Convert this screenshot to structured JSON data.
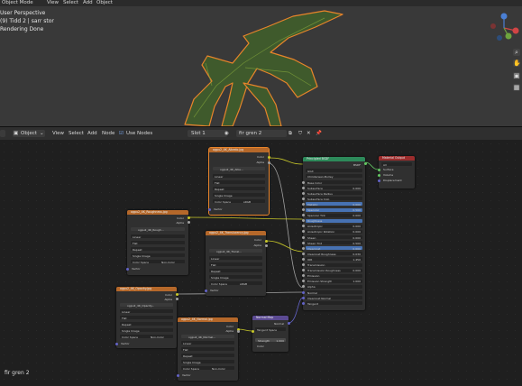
{
  "viewport": {
    "mode": "Object Mode",
    "menu": [
      "View",
      "Select",
      "Add",
      "Object"
    ],
    "info_lines": [
      "User Perspective",
      "(9) Tidd 2 | sarr stor",
      "Rendering Done"
    ]
  },
  "node_editor": {
    "editor_type": "Object",
    "menu": [
      "View",
      "Select",
      "Add",
      "Node"
    ],
    "use_nodes_label": "Use Nodes",
    "slot": "Slot 1",
    "material": "fir gren 2",
    "footer": "fir gren 2"
  },
  "nodes": {
    "color_tex": {
      "title": "ogpu2_4K_Albedo.jpg",
      "image": "ogpu2_4K_Albe...",
      "outputs": [
        "Color",
        "Alpha"
      ],
      "rows": [
        "Linear",
        "Flat",
        "Repeat",
        "Single Image"
      ],
      "color_space_label": "Color Space",
      "color_space": "sRGB",
      "input": "Vector"
    },
    "rough_tex": {
      "title": "ogpu2_4K_Roughness.jpg",
      "image": "ogpu2_4K_Rough...",
      "outputs": [
        "Color",
        "Alpha"
      ],
      "rows": [
        "Linear",
        "Flat",
        "Repeat",
        "Single Image"
      ],
      "color_space_label": "Color Space",
      "color_space": "Non-Color",
      "input": "Vector"
    },
    "trans_tex": {
      "title": "ogpu2_4K_Translucency.jpg",
      "image": "ogpu2_4K_Transl...",
      "outputs": [
        "Color",
        "Alpha"
      ],
      "rows": [
        "Linear",
        "Flat",
        "Repeat",
        "Single Image"
      ],
      "color_space_label": "Color Space",
      "color_space": "sRGB",
      "input": "Vector"
    },
    "opacity_tex": {
      "title": "ogpu2_4K_Opacity.jpg",
      "image": "ogpu2_4K_Opacity...",
      "outputs": [
        "Color",
        "Alpha"
      ],
      "rows": [
        "Linear",
        "Flat",
        "Repeat",
        "Single Image"
      ],
      "color_space_label": "Color Space",
      "color_space": "Non-Color",
      "input": "Vector"
    },
    "normal_tex": {
      "title": "ogpu2_4K_Normal.jpg",
      "image": "ogpu2_4K_Normal...",
      "outputs": [
        "Color",
        "Alpha"
      ],
      "rows": [
        "Linear",
        "Flat",
        "Repeat",
        "Single Image"
      ],
      "color_space_label": "Color Space",
      "color_space": "Non-Color",
      "input": "Vector"
    },
    "normal_map": {
      "title": "Normal Map",
      "output": "Normal",
      "space": "Tangent Space",
      "strength_label": "Strength",
      "strength": "1.000",
      "input": "Color"
    },
    "bsdf": {
      "title": "Principled BSDF",
      "output": "BSDF",
      "distribution": "GGX",
      "subsurface_method": "Christensen-Burley",
      "rows": [
        [
          "Base Color",
          ""
        ],
        [
          "Subsurface",
          "0.000"
        ],
        [
          "Subsurface Radius",
          ""
        ],
        [
          "Subsurface Colo",
          ""
        ],
        [
          "Metallic",
          "0.000"
        ],
        [
          "Specular",
          "0.500"
        ],
        [
          "Specular Tint",
          "0.000"
        ],
        [
          "Roughness",
          ""
        ],
        [
          "Anisotropic",
          "0.000"
        ],
        [
          "Anisotropic Rotation",
          "0.000"
        ],
        [
          "Sheen",
          "0.000"
        ],
        [
          "Sheen Tint",
          "0.500"
        ],
        [
          "Clearcoat",
          "0.000"
        ],
        [
          "Clearcoat Roughness",
          "0.030"
        ],
        [
          "IOR",
          "1.450"
        ],
        [
          "Transmission",
          ""
        ],
        [
          "Transmission Roughness",
          "0.000"
        ],
        [
          "Emission",
          ""
        ],
        [
          "Emission Strength",
          "1.000"
        ],
        [
          "Alpha",
          ""
        ],
        [
          "Normal",
          ""
        ],
        [
          "Clearcoat Normal",
          ""
        ],
        [
          "Tangent",
          ""
        ]
      ]
    },
    "output": {
      "title": "Material Output",
      "target": "All",
      "inputs": [
        "Surface",
        "Volume",
        "Displacement"
      ]
    }
  },
  "colors": {
    "texture_header": "#b5682a",
    "shader_header": "#2d8a5a",
    "output_header": "#9b2d2d",
    "vector_header": "#5b4a92",
    "selection": "#e8842a",
    "socket_color": "#c7c729",
    "socket_gray": "#a1a1a1",
    "socket_vector": "#6363c7",
    "socket_shader": "#63c763"
  }
}
